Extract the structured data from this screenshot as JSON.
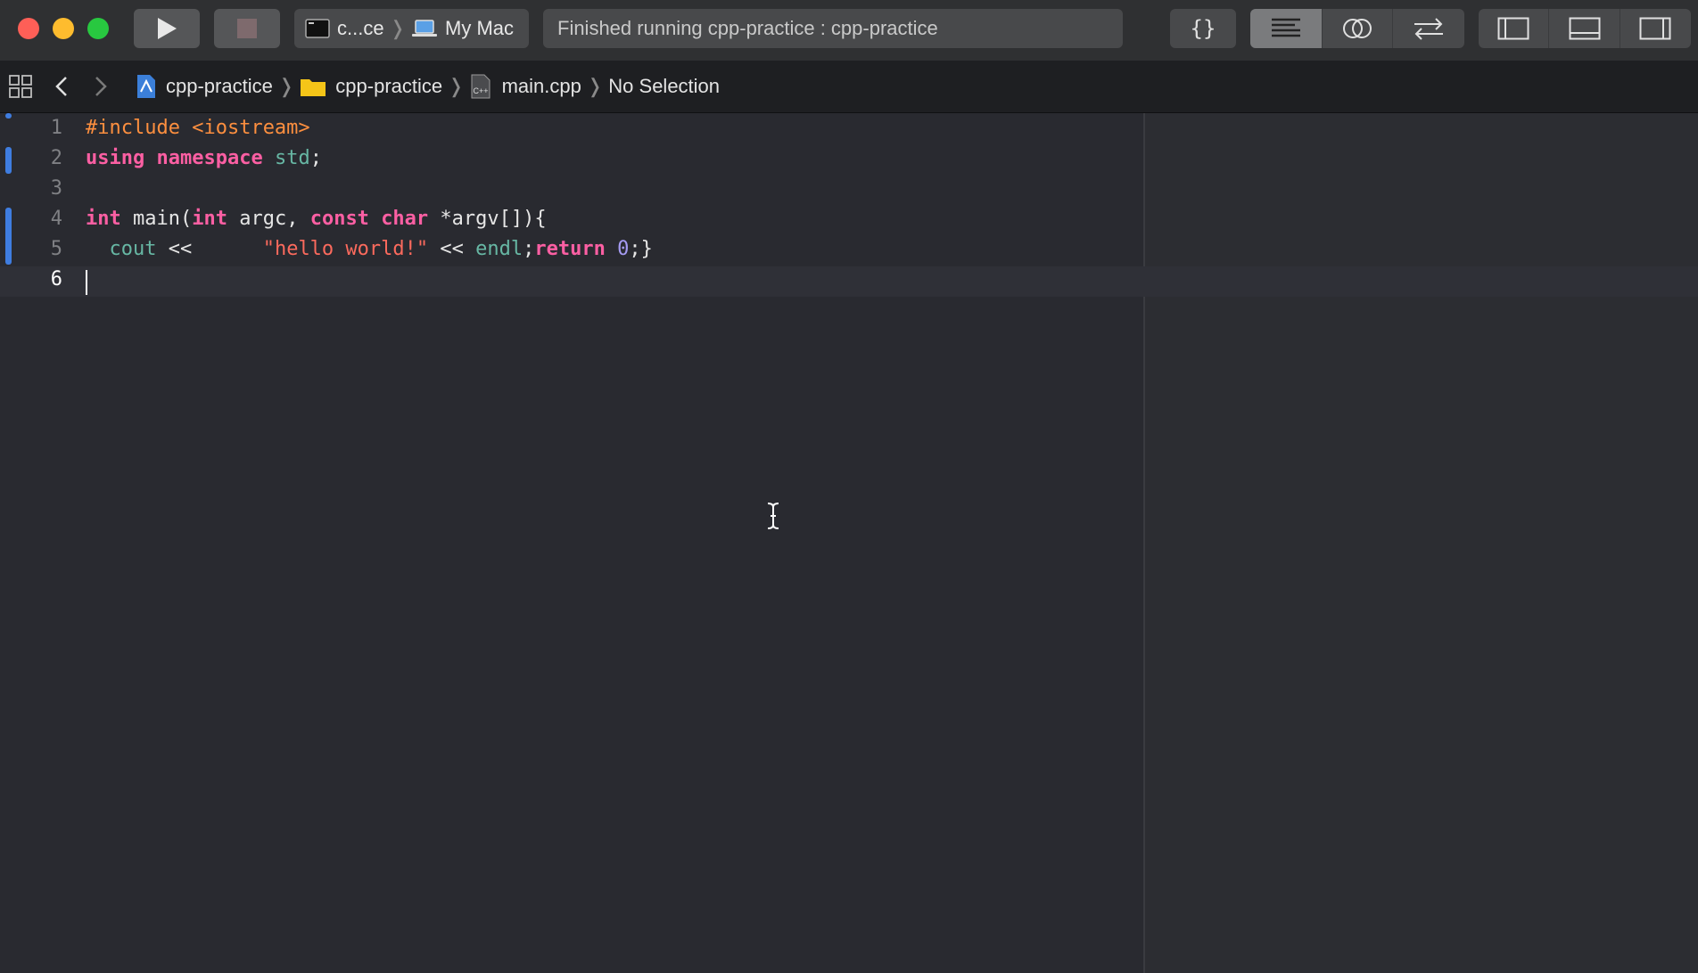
{
  "toolbar": {
    "scheme_target": "c...ce",
    "scheme_device": "My Mac",
    "status": "Finished running cpp-practice : cpp-practice",
    "icons": [
      "play-icon",
      "stop-icon",
      "code-review-icon",
      "standard-editor-icon",
      "assistant-editor-icon",
      "version-editor-icon",
      "navigator-toggle-icon",
      "debug-area-toggle-icon",
      "inspector-toggle-icon"
    ]
  },
  "jumpbar": {
    "project": "cpp-practice",
    "group": "cpp-practice",
    "file": "main.cpp",
    "symbol": "No Selection"
  },
  "editor": {
    "lines": [
      {
        "n": "1"
      },
      {
        "n": "2"
      },
      {
        "n": "3"
      },
      {
        "n": "4"
      },
      {
        "n": "5"
      },
      {
        "n": "6"
      }
    ],
    "tokens": {
      "include": "#include",
      "iostream": "<iostream>",
      "using": "using",
      "namespace": "namespace",
      "std": "std",
      "semi": ";",
      "int1": "int",
      "main_open": " main(",
      "int2": "int",
      "argc": " argc, ",
      "const": "const",
      "char": "char",
      "argv": " *argv[]){",
      "indent": "  ",
      "cout": "cout",
      "op1": " <<      ",
      "hello": "\"hello world!\"",
      "op2": " << ",
      "endl": "endl",
      "semi2": ";",
      "return": "return",
      "zero": "0",
      "close": ";}"
    }
  },
  "colors": {
    "keyword": "#fc5fa3",
    "preprocessor": "#fd8f3f",
    "string": "#fc6a5d",
    "number": "#a59bf3",
    "identifier": "#67b7a4",
    "change_marker": "#3f7de0"
  }
}
